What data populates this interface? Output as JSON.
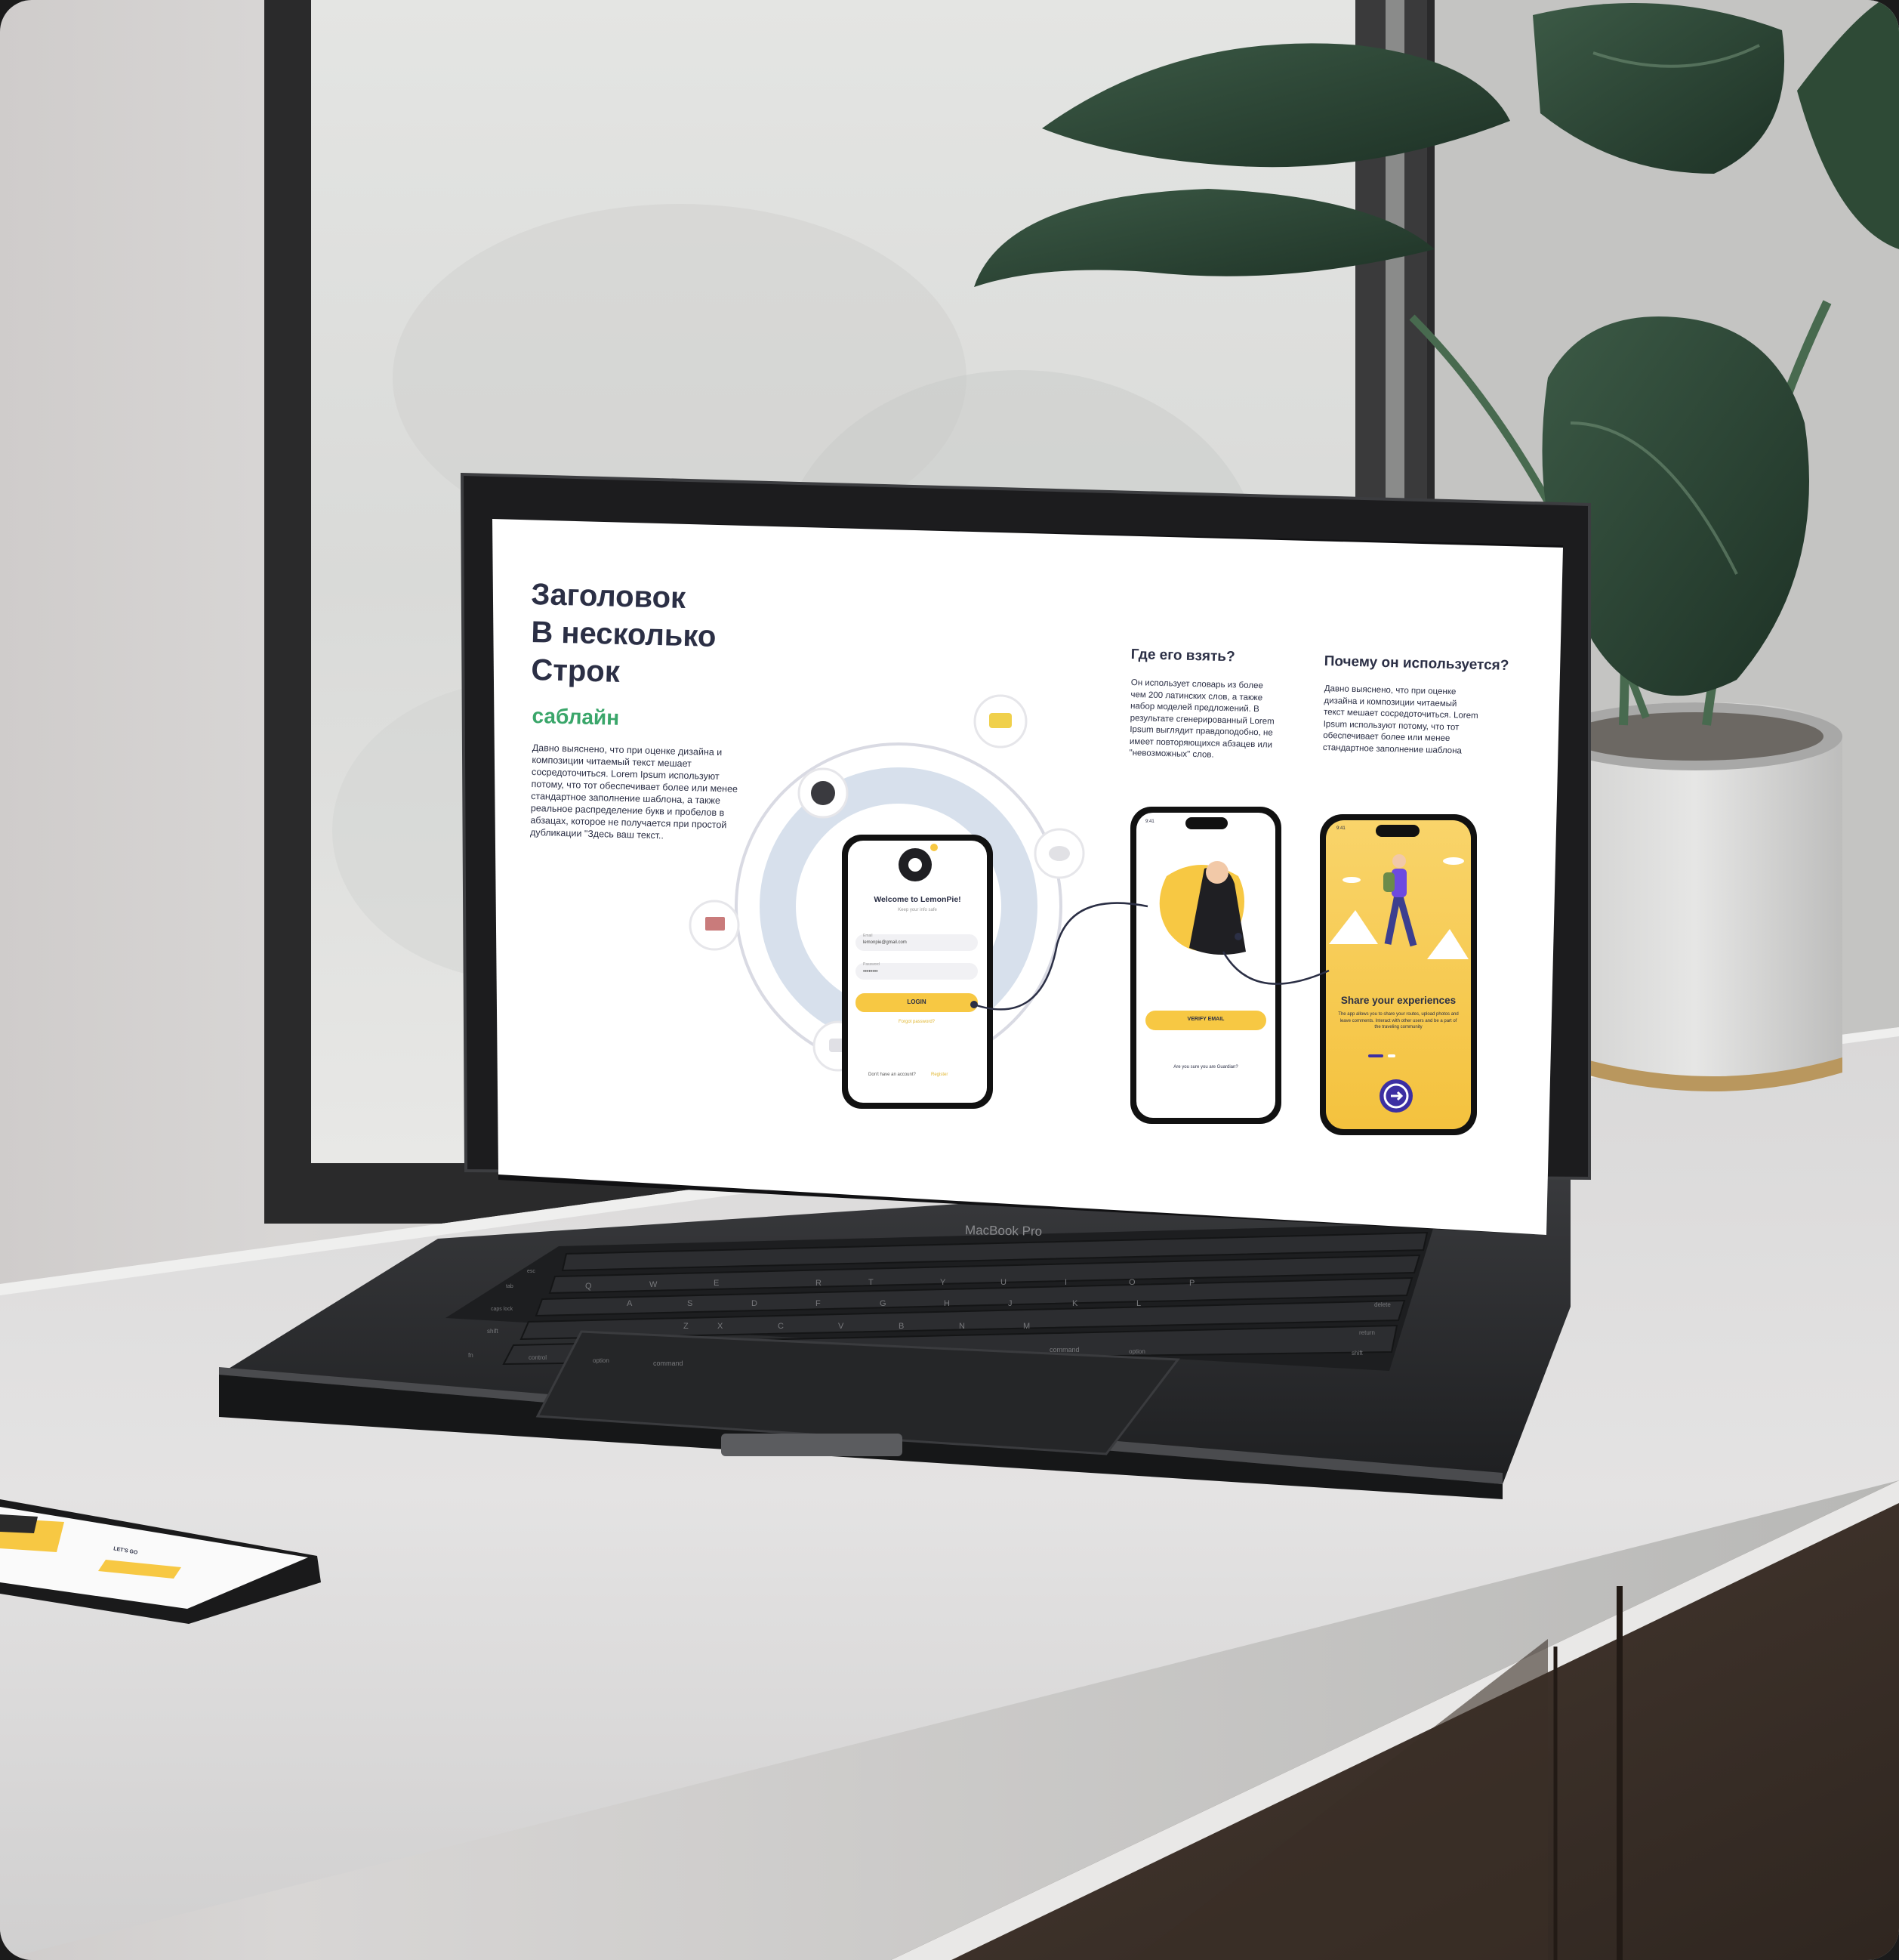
{
  "laptop": {
    "brand_label": "MacBook Pro",
    "screen": {
      "heading_lines": [
        "Заголовок",
        "В несколько",
        "Строк"
      ],
      "tagline": "саблайн",
      "intro_text": "Давно выяснено, что при оценке дизайна и композиции читаемый текст мешает сосредоточиться. Lorem Ipsum используют потому, что тот обеспечивает более или менее стандартное заполнение шаблона, а также реальное распределение букв и пробелов в абзацах, которое не получается при простой дубликации \"Здесь ваш текст..",
      "col1_title": "Где его взять?",
      "col1_text": "Он использует словарь из более чем 200 латинских слов, а также набор моделей предложений. В результате сгенерированный Lorem Ipsum выглядит правдоподобно, не имеет повторяющихся абзацев или \"невозможных\" слов.",
      "col2_title": "Почему он используется?",
      "col2_text": "Давно выяснено, что при оценке дизайна и композиции читаемый текст мешает сосредоточиться. Lorem Ipsum используют потому, что тот обеспечивает более или менее стандартное заполнение шаблона",
      "phone1": {
        "title": "Welcome to LemonPie!",
        "subtitle": "Keep your info safe",
        "email_label": "Email",
        "email_value": "lemonpie@gmail.com",
        "password_label": "Password",
        "password_value": "••••••••",
        "login_button": "LOGIN",
        "forgot_link": "Forgot password?",
        "signup_prompt": "Don't have an account?",
        "signup_link": "Register"
      },
      "phone2": {
        "time": "9:41",
        "verify_button": "VERIFY EMAIL",
        "question": "Are you sure you are Guardian?"
      },
      "phone3": {
        "time": "9:41",
        "title": "Share your experiences",
        "body": "The app allows you to share your routes, upload photos and leave comments. Interact with other users and be a part of the traveling community"
      }
    },
    "keyboard_keys": [
      "esc",
      "tab",
      "caps lock",
      "shift",
      "fn",
      "control",
      "option",
      "command",
      "command",
      "option",
      "Q",
      "W",
      "E",
      "R",
      "T",
      "Y",
      "U",
      "I",
      "O",
      "P",
      "A",
      "S",
      "D",
      "F",
      "G",
      "H",
      "J",
      "K",
      "L",
      "Z",
      "X",
      "C",
      "V",
      "B",
      "N",
      "M",
      "delete",
      "return",
      "shift"
    ]
  },
  "small_phone": {
    "button_label": "LET'S GO"
  },
  "colors": {
    "accent_yellow": "#f7c843",
    "accent_green": "#3aa66a",
    "heading": "#2b2f45",
    "laptop_body": "#2a2b2e"
  }
}
